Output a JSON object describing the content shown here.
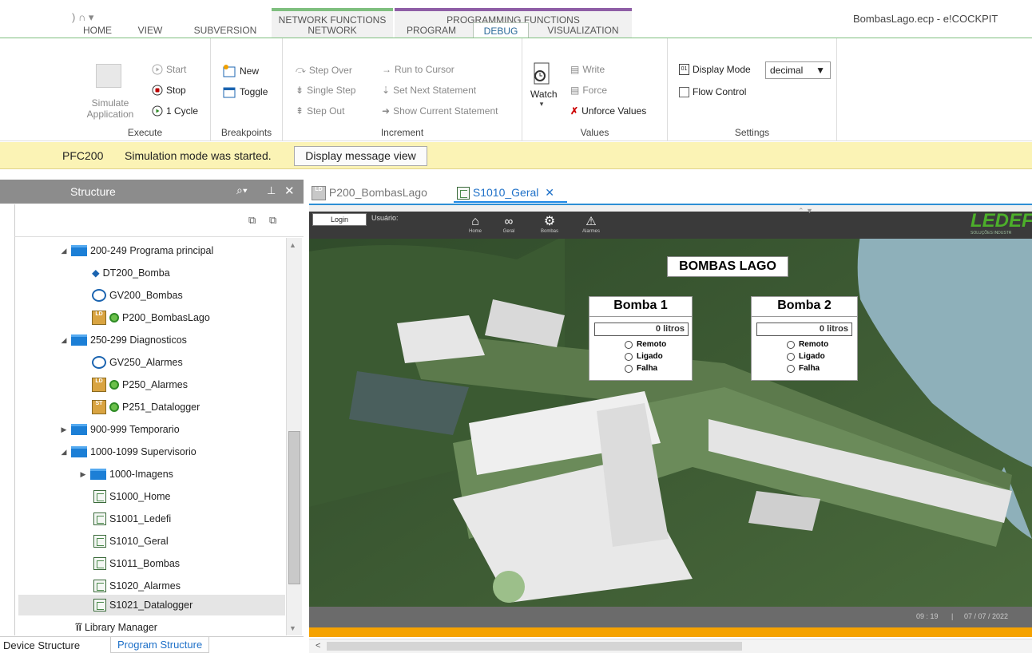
{
  "window": {
    "qat_glyphs": ") ∩ ▾",
    "title": "BombasLago.ecp - e!COCKPIT"
  },
  "context_tabs": {
    "network": "NETWORK FUNCTIONS",
    "programming": "PROGRAMMING FUNCTIONS"
  },
  "tabs": [
    "HOME",
    "VIEW",
    "SUBVERSION",
    "NETWORK",
    "PROGRAM",
    "DEBUG",
    "VISUALIZATION"
  ],
  "ribbon": {
    "execute": {
      "label": "Execute",
      "simulate": "Simulate",
      "application": "Application",
      "start": "Start",
      "stop": "Stop",
      "cycle": "1 Cycle"
    },
    "breakpoints": {
      "label": "Breakpoints",
      "new": "New",
      "toggle": "Toggle"
    },
    "increment": {
      "label": "Increment",
      "step_over": "Step Over",
      "single_step": "Single Step",
      "step_out": "Step Out",
      "run_to_cursor": "Run to Cursor",
      "set_next": "Set Next Statement",
      "show_current": "Show Current Statement"
    },
    "values": {
      "label": "Values",
      "watch": "Watch",
      "write": "Write",
      "force": "Force",
      "unforce": "Unforce Values"
    },
    "settings": {
      "label": "Settings",
      "display_mode": "Display Mode",
      "display_mode_value": "decimal",
      "flow_control": "Flow Control"
    }
  },
  "message_bar": {
    "device": "PFC200",
    "message": "Simulation mode was started.",
    "button": "Display message view"
  },
  "left_panel": {
    "title": "Structure",
    "tree": [
      {
        "label": "200-249 Programa principal",
        "type": "folder",
        "expanded": true
      },
      {
        "label": "DT200_Bomba",
        "type": "datatype"
      },
      {
        "label": "GV200_Bombas",
        "type": "gvl"
      },
      {
        "label": "P200_BombasLago",
        "type": "pou-ld"
      },
      {
        "label": "250-299 Diagnosticos",
        "type": "folder",
        "expanded": true
      },
      {
        "label": "GV250_Alarmes",
        "type": "gvl"
      },
      {
        "label": "P250_Alarmes",
        "type": "pou-ld"
      },
      {
        "label": "P251_Datalogger",
        "type": "pou-st"
      },
      {
        "label": "900-999 Temporario",
        "type": "folder",
        "expanded": false
      },
      {
        "label": "1000-1099 Supervisorio",
        "type": "folder",
        "expanded": true
      },
      {
        "label": "1000-Imagens",
        "type": "folder",
        "expanded": false
      },
      {
        "label": "S1000_Home",
        "type": "visu"
      },
      {
        "label": "S1001_Ledefi",
        "type": "visu"
      },
      {
        "label": "S1010_Geral",
        "type": "visu"
      },
      {
        "label": "S1011_Bombas",
        "type": "visu"
      },
      {
        "label": "S1020_Alarmes",
        "type": "visu"
      },
      {
        "label": "S1021_Datalogger",
        "type": "visu",
        "selected": true
      },
      {
        "label": "Library Manager",
        "type": "library"
      }
    ],
    "bottom_tabs": [
      "Device Structure",
      "Program Structure"
    ]
  },
  "editor_tabs": [
    "P200_BombasLago",
    "S1010_Geral"
  ],
  "visualization": {
    "login": "Login",
    "usuario": "Usuário:",
    "nav": [
      "Home",
      "Geral",
      "Bombas",
      "Alarmes"
    ],
    "logo": "LEDEF",
    "logo_sub": "SOLUÇÕES INDUSTR",
    "title": "BOMBAS LAGO",
    "pumps": [
      {
        "name": "Bomba 1",
        "volume": "0 litros",
        "states": [
          "Remoto",
          "Ligado",
          "Falha"
        ]
      },
      {
        "name": "Bomba 2",
        "volume": "0 litros",
        "states": [
          "Remoto",
          "Ligado",
          "Falha"
        ]
      }
    ],
    "time": "09 : 19",
    "date": "07 / 07 /  2022"
  },
  "colors": {
    "accent_green": "#7fbf7f",
    "accent_purple": "#8e5ea6",
    "tab_blue": "#1e88e5",
    "message_yellow": "#fbf3b5",
    "orange": "#f5a200"
  }
}
